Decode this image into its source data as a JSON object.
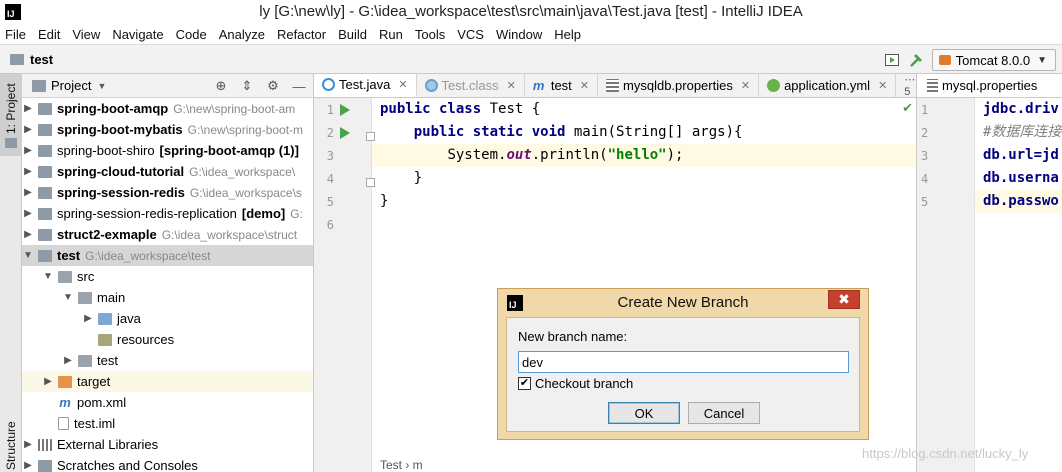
{
  "window": {
    "title": "ly [G:\\new\\ly] - G:\\idea_workspace\\test\\src\\main\\java\\Test.java [test] - IntelliJ IDEA",
    "logo_text": "IJ"
  },
  "menu": [
    "File",
    "Edit",
    "View",
    "Navigate",
    "Code",
    "Analyze",
    "Refactor",
    "Build",
    "Run",
    "Tools",
    "VCS",
    "Window",
    "Help"
  ],
  "navbar": {
    "crumb": "test",
    "run_config": "Tomcat 8.0.0"
  },
  "sidebar": {
    "project_tab": "1: Project",
    "structure_tab": "Structure"
  },
  "project_panel": {
    "title": "Project",
    "rows": [
      {
        "name": "spring-boot-amqp",
        "path": "G:\\new\\spring-boot-am"
      },
      {
        "name": "spring-boot-mybatis",
        "path": "G:\\new\\spring-boot-m"
      },
      {
        "name": "spring-boot-shiro",
        "suffix": "[spring-boot-amqp (1)]"
      },
      {
        "name": "spring-cloud-tutorial",
        "path": "G:\\idea_workspace\\"
      },
      {
        "name": "spring-session-redis",
        "path": "G:\\idea_workspace\\s"
      },
      {
        "name": "spring-session-redis-replication",
        "suffix": "[demo]",
        "path": "G:"
      },
      {
        "name": "struct2-exmaple",
        "path": "G:\\idea_workspace\\struct"
      },
      {
        "name": "test",
        "path": "G:\\idea_workspace\\test"
      },
      {
        "name": "src"
      },
      {
        "name": "main"
      },
      {
        "name": "java"
      },
      {
        "name": "resources"
      },
      {
        "name": "test"
      },
      {
        "name": "target"
      },
      {
        "name": "pom.xml"
      },
      {
        "name": "test.iml"
      },
      {
        "name": "External Libraries"
      },
      {
        "name": "Scratches and Consoles"
      }
    ]
  },
  "editor_tabs": [
    {
      "label": "Test.java"
    },
    {
      "label": "Test.class"
    },
    {
      "label": "test"
    },
    {
      "label": "mysqldb.properties"
    },
    {
      "label": "application.yml"
    }
  ],
  "tabs_overflow": "⋯5",
  "editor": {
    "line_numbers": [
      "1",
      "2",
      "3",
      "4",
      "5",
      "6"
    ],
    "code": {
      "l1_kw": "public class",
      "l1_rest": " Test {",
      "l2_kw": "public static void",
      "l2_rest": " main(String[] args){",
      "l3_a": "System.",
      "l3_b": "out",
      "l3_c": ".println(",
      "l3_str": "\"hello\"",
      "l3_d": ");",
      "l4": "}",
      "l5": "}",
      "l6": ""
    },
    "bottom_crumb": "Test  ›  m"
  },
  "right_editor": {
    "tab_label": "mysql.properties",
    "line_numbers": [
      "1",
      "2",
      "3",
      "4",
      "5"
    ],
    "lines": [
      "jdbc.driv",
      "#数据库连接",
      "db.url=jd",
      "db.userna",
      "db.passwo"
    ]
  },
  "dialog": {
    "title": "Create New Branch",
    "logo_text": "IJ",
    "close": "✖",
    "branch_label": "New branch name:",
    "branch_value": "dev",
    "checkout_label": "Checkout branch",
    "checkout_checked": "✔",
    "ok": "OK",
    "cancel": "Cancel"
  },
  "watermark": "https://blog.csdn.net/lucky_ly"
}
